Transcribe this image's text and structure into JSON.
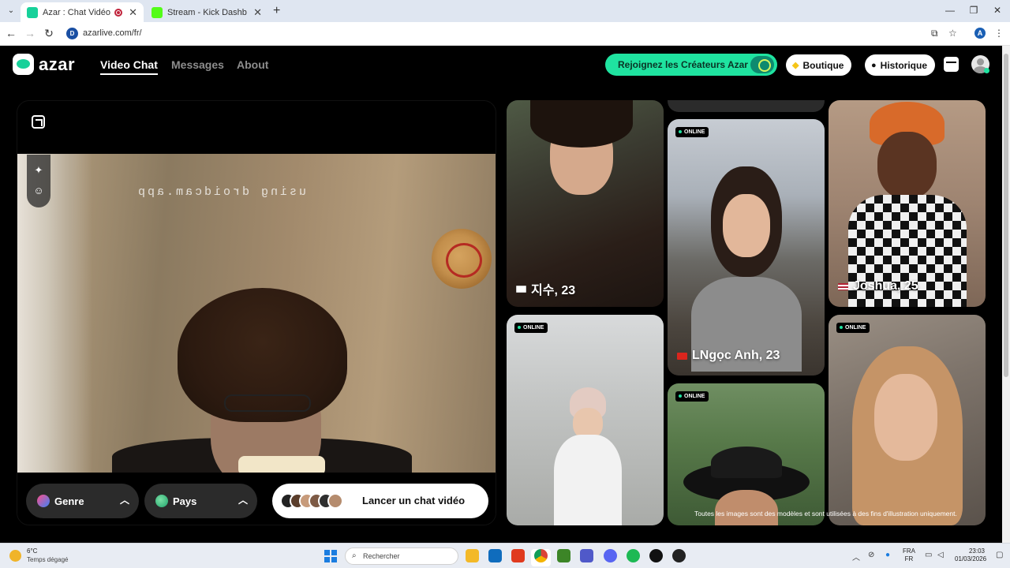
{
  "browser": {
    "tabs": [
      {
        "title": "Azar : Chat Vidéo avec de n",
        "active": true
      },
      {
        "title": "Stream - Kick Dashboard",
        "active": false
      }
    ],
    "url": "azarlive.com/fr/",
    "profile_initial": "A",
    "site_badge": "D"
  },
  "header": {
    "logo": "azar",
    "nav": [
      {
        "label": "Video Chat",
        "active": true
      },
      {
        "label": "Messages",
        "active": false
      },
      {
        "label": "About",
        "active": false
      }
    ],
    "creators_label": "Rejoignez les Créateurs Azar",
    "boutique_label": "Boutique",
    "historique_label": "Historique"
  },
  "video": {
    "watermark": "using droidcam.app",
    "genre_label": "Genre",
    "pays_label": "Pays",
    "launch_label": "Lancer un chat vidéo"
  },
  "cards": {
    "c1": {
      "name": "지수, 23",
      "flag": "KR"
    },
    "c3": {
      "name": "Joshua, 25",
      "flag": "US"
    },
    "c4": {
      "name": "LNgọc Anh, 23",
      "flag": "VN"
    },
    "online_label": "ONLINE",
    "disclaimer": "Toutes les images sont des modèles et sont utilisées à des fins d'illustration uniquement."
  },
  "taskbar": {
    "temp": "6°C",
    "weather": "Temps dégagé",
    "search_placeholder": "Rechercher",
    "lang_top": "FRA",
    "lang_bottom": "FR",
    "time": "23:03",
    "date": "01/03/2026"
  },
  "colors": {
    "brand_green": "#1fe3a0",
    "background": "#000000"
  }
}
